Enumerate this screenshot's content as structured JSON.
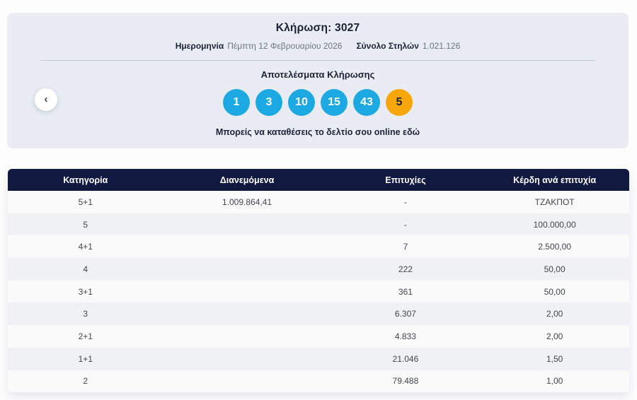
{
  "draw": {
    "title": "Κλήρωση: 3027",
    "date_label": "Ημερομηνία",
    "date_value": "Πέμπτη 12 Φεβρουαρίου 2026",
    "columns_label": "Σύνολο Στηλών",
    "columns_value": "1.021.126"
  },
  "results": {
    "heading": "Αποτελέσματα Κλήρωσης",
    "numbers": [
      "1",
      "3",
      "10",
      "15",
      "43"
    ],
    "joker": "5",
    "deposit_link": "Μπορείς να καταθέσεις το δελτίο σου online εδώ"
  },
  "nav": {
    "prev_arrow": "‹"
  },
  "table": {
    "headers": [
      "Κατηγορία",
      "Διανεμόμενα",
      "Επιτυχίες",
      "Κέρδη ανά επιτυχία"
    ],
    "rows": [
      [
        "5+1",
        "1.009.864,41",
        "-",
        "ΤΖΑΚΠΟΤ"
      ],
      [
        "5",
        "",
        "-",
        "100.000,00"
      ],
      [
        "4+1",
        "",
        "7",
        "2.500,00"
      ],
      [
        "4",
        "",
        "222",
        "50,00"
      ],
      [
        "3+1",
        "",
        "361",
        "50,00"
      ],
      [
        "3",
        "",
        "6.307",
        "2,00"
      ],
      [
        "2+1",
        "",
        "4.833",
        "2,00"
      ],
      [
        "1+1",
        "",
        "21.046",
        "1,50"
      ],
      [
        "2",
        "",
        "79.488",
        "1,00"
      ]
    ]
  },
  "colors": {
    "ball_blue": "#1ca9e2",
    "ball_orange": "#f7a70b",
    "header_bg": "#111941",
    "panel_bg": "#e9edf3",
    "navy_text": "#1c2136"
  }
}
